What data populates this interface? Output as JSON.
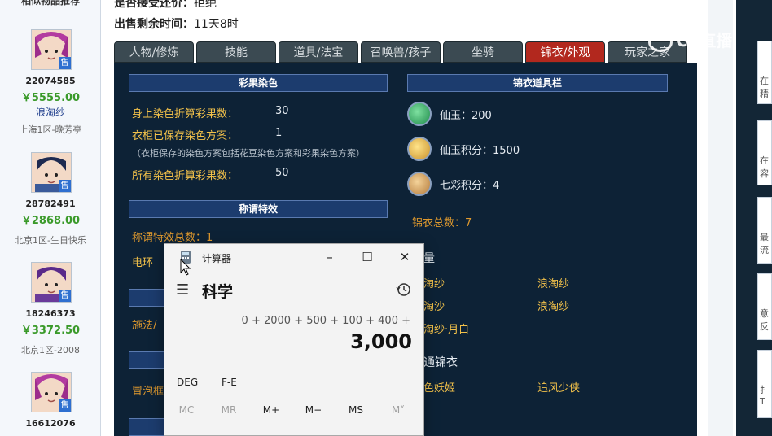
{
  "sidebar": {
    "header": "相似物品推荐",
    "sold_badge": "售",
    "sellers": [
      {
        "id": "22074585",
        "price": "￥5555.00",
        "name": "浪淘纱",
        "server": "上海1区-晚芳亭"
      },
      {
        "id": "28782491",
        "price": "￥2868.00",
        "name": "",
        "server": "北京1区-生日快乐"
      },
      {
        "id": "18246373",
        "price": "￥3372.50",
        "name": "",
        "server": "北京1区-2008"
      },
      {
        "id": "16612076",
        "price": "",
        "name": "",
        "server": ""
      }
    ]
  },
  "info": {
    "bargain_label": "是否接受还价：",
    "bargain_value": "拒绝",
    "remaining_label": "出售剩余时间：",
    "remaining_value": "11天8时"
  },
  "tabs": [
    {
      "label": "人物/修炼"
    },
    {
      "label": "技能"
    },
    {
      "label": "道具/法宝"
    },
    {
      "label": "召唤兽/孩子"
    },
    {
      "label": "坐骑"
    },
    {
      "label": "锦衣/外观"
    },
    {
      "label": "玩家之家"
    }
  ],
  "dye": {
    "title": "彩果染色",
    "rows": [
      {
        "label": "身上染色折算彩果数：",
        "value": "30"
      },
      {
        "label": "衣柜已保存染色方案：",
        "value": "1"
      },
      {
        "label": "所有染色折算彩果数：",
        "value": "50"
      }
    ],
    "note": "（衣柜保存的染色方案包括花豆染色方案和彩果染色方案）"
  },
  "title_effects": {
    "title": "称谓特效",
    "total": "称谓特效总数：1",
    "first_item": "电环"
  },
  "partial_left": {
    "row1": "施法/",
    "row2": "冒泡框"
  },
  "wardrobe": {
    "title": "锦衣道具栏",
    "items": [
      {
        "icon": "jade-coin-icon",
        "text": "仙玉：200"
      },
      {
        "icon": "jade-points-icon",
        "text": "仙玉积分：1500"
      },
      {
        "icon": "rainbow-points-icon",
        "text": "七彩积分：4"
      }
    ],
    "total": "锦衣总数：7",
    "quantity_suffix": "量",
    "outfits": [
      "淘纱",
      "浪淘纱",
      "淘沙",
      "浪淘纱",
      "淘纱·月白"
    ],
    "normal_label": "通锦衣",
    "normal_items": [
      "色妖姬",
      "追风少侠"
    ]
  },
  "watermark": "CC直播",
  "right_cards": [
    "在",
    "精",
    "在",
    "容",
    "最",
    "流",
    "意",
    "反",
    "扌",
    "T"
  ],
  "calculator": {
    "title": "计算器",
    "mode": "科学",
    "expression": "0 + 2000 + 500 + 100 + 400 +",
    "result": "3,000",
    "options": [
      "DEG",
      "F-E"
    ],
    "memory": [
      "MC",
      "MR",
      "M+",
      "M−",
      "MS",
      "M˅"
    ]
  }
}
